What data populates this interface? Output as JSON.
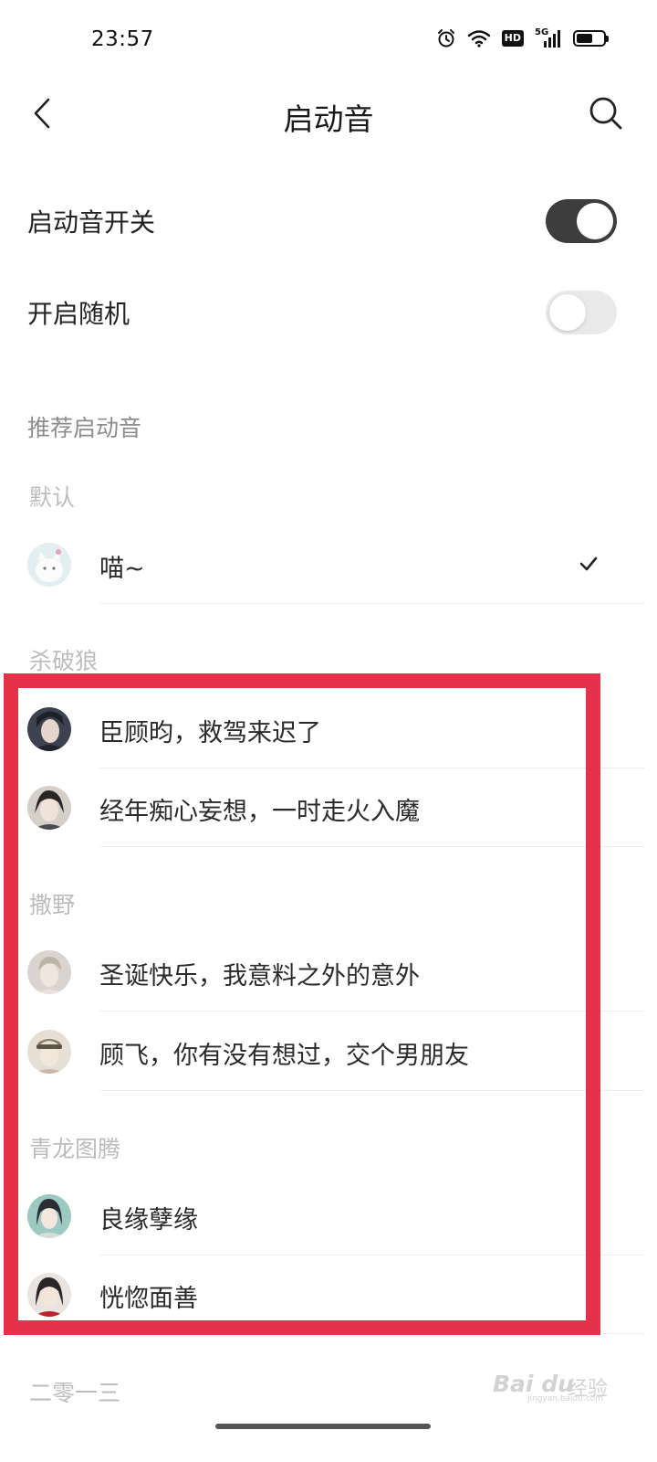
{
  "status_bar": {
    "time": "23:57",
    "hd_badge": "HD",
    "network": "5G",
    "battery_level": 0.6,
    "icons": [
      "alarm-icon",
      "wifi-icon",
      "hd-icon",
      "signal-5g-icon",
      "battery-icon"
    ]
  },
  "header": {
    "title": "启动音",
    "back_icon": "chevron-left-icon",
    "search_icon": "search-icon"
  },
  "settings": {
    "startup_sound_switch": {
      "label": "启动音开关",
      "on": true
    },
    "random_switch": {
      "label": "开启随机",
      "on": false
    }
  },
  "section_title": "推荐启动音",
  "groups": [
    {
      "title": "默认",
      "items": [
        {
          "label": "喵~",
          "selected": true
        }
      ]
    },
    {
      "title": "杀破狼",
      "items": [
        {
          "label": "臣顾昀，救驾来迟了",
          "selected": false
        },
        {
          "label": "经年痴心妄想，一时走火入魔",
          "selected": false
        }
      ]
    },
    {
      "title": "撒野",
      "items": [
        {
          "label": "圣诞快乐，我意料之外的意外",
          "selected": false
        },
        {
          "label": "顾飞，你有没有想过，交个男朋友",
          "selected": false
        }
      ]
    },
    {
      "title": "青龙图腾",
      "items": [
        {
          "label": "良缘孽缘",
          "selected": false
        },
        {
          "label": "恍惚面善",
          "selected": false
        }
      ]
    },
    {
      "title": "二零一三",
      "items": []
    }
  ],
  "watermark": {
    "brand": "Bai du",
    "cn": "经验",
    "sub": "jingyan.baidu.com"
  },
  "colors": {
    "highlight": "#e5314a",
    "switch_on": "#3d3d3d",
    "switch_off": "#e9e9e9",
    "section_text": "#8c8c8c",
    "group_text": "#bcbcbc"
  }
}
